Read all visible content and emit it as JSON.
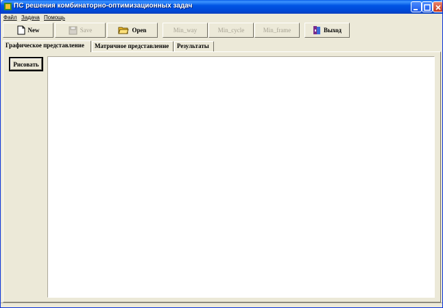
{
  "window": {
    "title": "ПС решения комбинаторно-оптимизационных задач",
    "icon": "app-icon"
  },
  "menu": {
    "items": [
      "Файл",
      "Задача",
      "Помощь"
    ]
  },
  "toolbar": {
    "new_label": "New",
    "save_label": "Save",
    "open_label": "Open",
    "min_way_label": "Min_way",
    "min_cycle_label": "Min_cycle",
    "min_frame_label": "Min_frame",
    "exit_label": "Выход"
  },
  "tabs": [
    "Графическое представление",
    "Матричное представление",
    "Результаты"
  ],
  "panel": {
    "draw_button_label": "Рисовать"
  },
  "colors": {
    "titlebar": "#0055e5",
    "face": "#ece9d8",
    "canvas": "#ffffff"
  }
}
